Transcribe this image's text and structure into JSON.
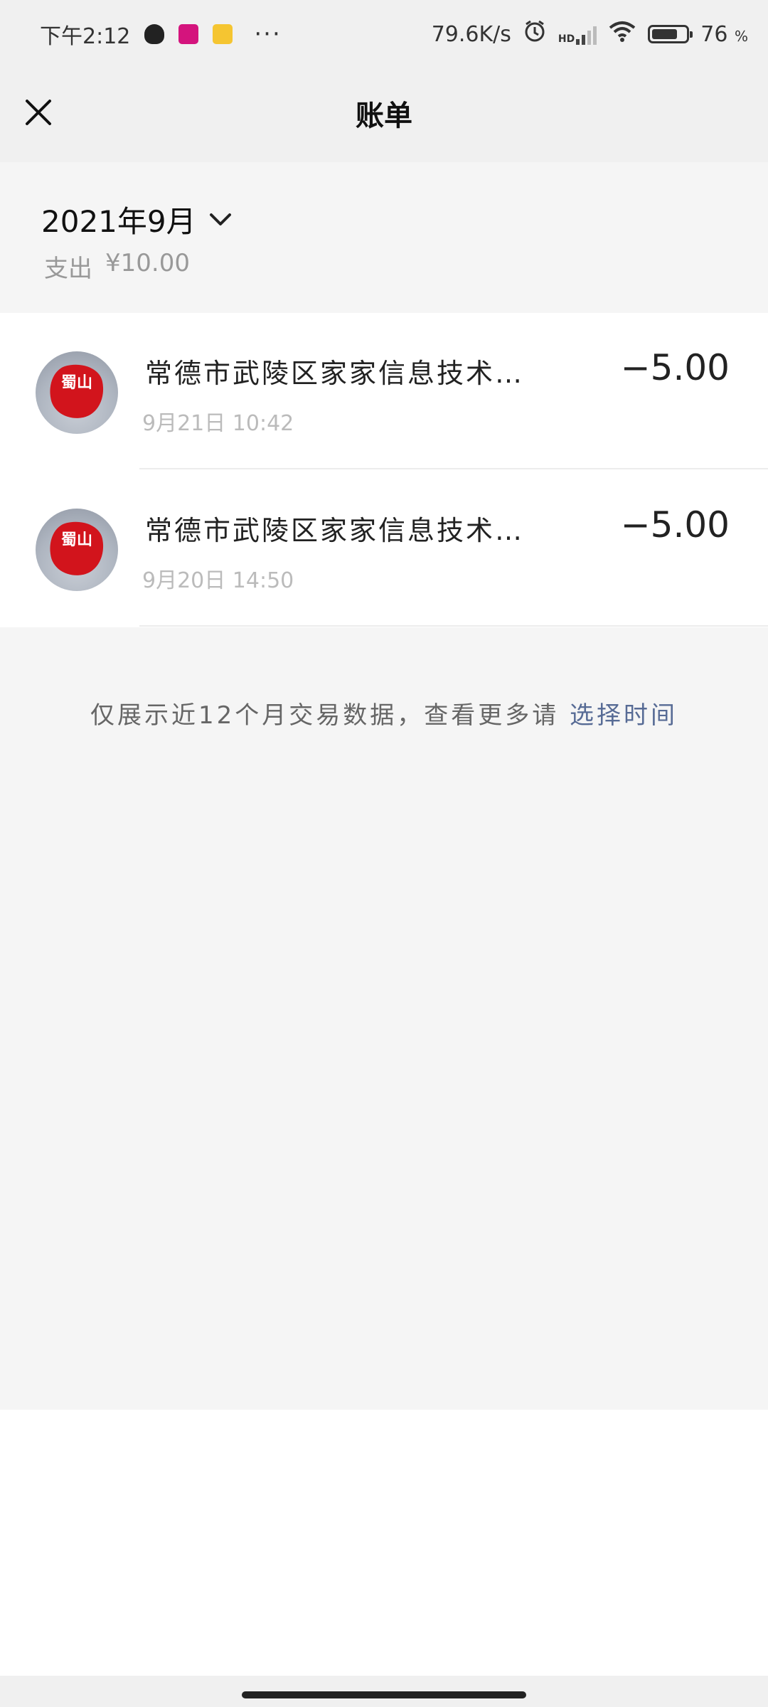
{
  "status_bar": {
    "time": "下午2:12",
    "dots": "···",
    "net_speed": "79.6K/s",
    "hd_label": "HD",
    "battery_percent": "76",
    "battery_unit": "%",
    "battery_level": 0.76,
    "notification_icons": [
      "qq-icon",
      "app-icon",
      "weibo-icon"
    ]
  },
  "nav": {
    "title": "账单",
    "close_icon": "close-icon"
  },
  "month_header": {
    "month_label": "2021年9月",
    "summary_label": "支出",
    "summary_amount": "¥10.00"
  },
  "transactions": [
    {
      "merchant": "常德市武陵区家家信息技术…",
      "time": "9月21日 10:42",
      "amount": "−5.00",
      "avatar_text": "蜀山"
    },
    {
      "merchant": "常德市武陵区家家信息技术…",
      "time": "9月20日 14:50",
      "amount": "−5.00",
      "avatar_text": "蜀山"
    }
  ],
  "footer": {
    "note": "仅展示近12个月交易数据，查看更多请",
    "link": "选择时间"
  },
  "colors": {
    "link": "#576b95",
    "avatar_red": "#d2141c",
    "background": "#f5f5f5"
  }
}
